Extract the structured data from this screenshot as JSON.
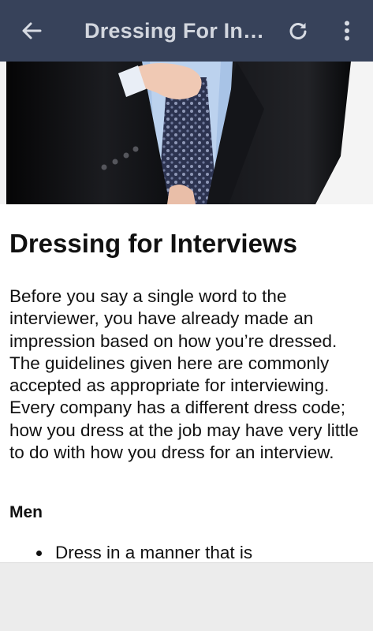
{
  "toolbar": {
    "title": "Dressing For In…",
    "back_icon": "arrow-left-icon",
    "refresh_icon": "refresh-icon",
    "more_icon": "more-vertical-icon",
    "background": "#37425a"
  },
  "hero": {
    "description_icon": "hero-image"
  },
  "article": {
    "heading": "Dressing for Interviews",
    "paragraph": "Before you say a single word to the interviewer, you have already made an impression based on how you’re dressed. The guidelines given here are commonly accepted as appropriate for interviewing. Every company has a different dress code; how you dress at the job may have very little to do with how you dress for an interview.",
    "subheading": "Men",
    "list": [
      "Dress in a manner that is"
    ]
  }
}
